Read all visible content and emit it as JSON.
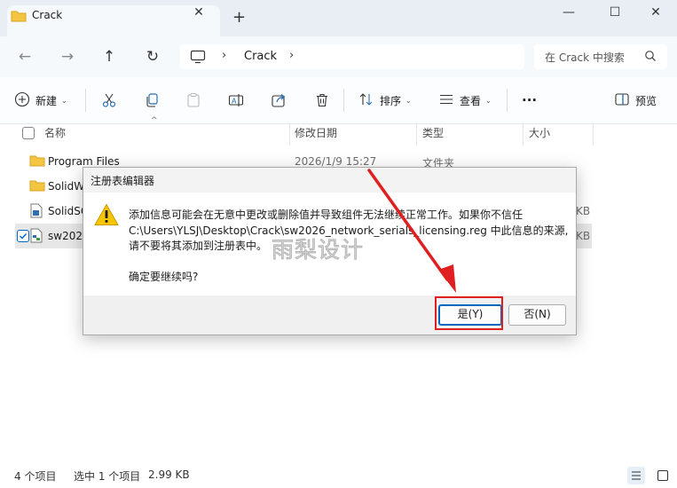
{
  "window": {
    "tab_title": "Crack",
    "tab_close_glyph": "✕",
    "new_tab_glyph": "+",
    "minimize_glyph": "—",
    "maximize_glyph": "☐",
    "close_glyph": "✕"
  },
  "nav": {
    "back_glyph": "←",
    "forward_glyph": "→",
    "up_glyph": "↑",
    "refresh_glyph": "↻",
    "breadcrumb": [
      "Crack"
    ],
    "separator_glyph": "›",
    "search_placeholder": "在 Crack 中搜索"
  },
  "toolbar": {
    "new_label": "新建",
    "sort_label": "排序",
    "view_label": "查看",
    "more_label": "···",
    "preview_label": "预览",
    "chevron": "⌄",
    "icons": [
      "plus-icon",
      "cut-icon",
      "copy-icon",
      "paste-icon",
      "rename-icon",
      "share-icon",
      "delete-icon",
      "sort-icon",
      "view-icon",
      "more-icon",
      "preview-icon"
    ]
  },
  "columns": {
    "name": "名称",
    "date": "修改日期",
    "type": "类型",
    "size": "大小",
    "sort_caret": "^"
  },
  "files": [
    {
      "name": "Program Files",
      "date": "2026/1/9 15:27",
      "type": "文件夹",
      "size": "",
      "icon": "folder-icon",
      "selected": false
    },
    {
      "name": "SolidW",
      "date": "",
      "type": "",
      "size": "",
      "icon": "folder-icon",
      "selected": false
    },
    {
      "name": "SolidSC",
      "date": "",
      "type": "",
      "size": "KB",
      "icon": "document-icon",
      "selected": false
    },
    {
      "name": "sw2026",
      "date": "",
      "type": "",
      "size": "KB",
      "icon": "registry-file-icon",
      "selected": true
    }
  ],
  "dialog": {
    "title": "注册表编辑器",
    "icon": "warning-icon",
    "message_lines": [
      "添加信息可能会在无意中更改或删除值并导致组件无法继续正常工作。如果你不信任",
      "C:\\Users\\YLSJ\\Desktop\\Crack\\sw2026_network_serials_licensing.reg 中此信息的来源,",
      "请不要将其添加到注册表中。"
    ],
    "question": "确定要继续吗?",
    "yes_label": "是(Y)",
    "no_label": "否(N)"
  },
  "annotation": {
    "watermark": "雨梨设计",
    "highlight_color": "#e02020"
  },
  "status": {
    "item_count": "4 个项目",
    "selection": "选中 1 个项目",
    "size": "2.99 KB"
  },
  "colors": {
    "accent": "#0067c0",
    "folder": "#f4c542",
    "warning": "#f7c600",
    "arrow": "#e02020"
  }
}
